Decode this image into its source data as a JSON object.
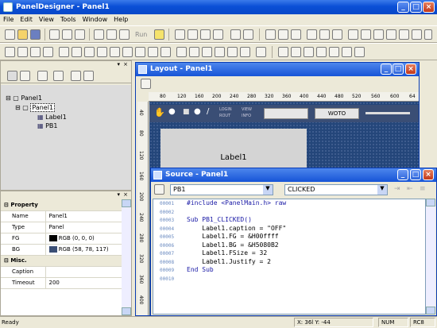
{
  "app": {
    "title": "PanelDesigner - Panel1"
  },
  "menu": [
    "File",
    "Edit",
    "View",
    "Tools",
    "Window",
    "Help"
  ],
  "toolbar": {
    "run_label": "Run"
  },
  "tree": {
    "root": "Panel1",
    "child": "Panel1",
    "items": [
      "Label1",
      "PB1"
    ]
  },
  "properties": {
    "section_property": "Property",
    "rows": [
      {
        "name": "Name",
        "value": "Panel1"
      },
      {
        "name": "Type",
        "value": "Panel"
      },
      {
        "name": "FG",
        "value": "RGB (0, 0, 0)",
        "swatch": "#000000"
      },
      {
        "name": "BG",
        "value": "RGB (58, 78, 117)",
        "swatch": "#3a4e75"
      }
    ],
    "section_misc": "Misc.",
    "misc_rows": [
      {
        "name": "Caption",
        "value": ""
      },
      {
        "name": "Timeout",
        "value": "200"
      }
    ]
  },
  "layout_window": {
    "title": "Layout - Panel1",
    "ruler_ticks": [
      "80",
      "120",
      "160",
      "200",
      "240",
      "280",
      "320",
      "360",
      "400",
      "440",
      "480",
      "520",
      "560",
      "600",
      "64"
    ],
    "vruler_ticks": [
      "40",
      "80",
      "120",
      "160",
      "200",
      "240",
      "280",
      "320",
      "360",
      "400"
    ],
    "label_text": "Label1",
    "mini_button": "WOTO",
    "mini_small_1": "LOGIN",
    "mini_small_2": "ROUT",
    "mini_small_3": "VIEW",
    "mini_small_4": "INFO"
  },
  "source_window": {
    "title": "Source - Panel1",
    "object_select": "PB1",
    "event_select": "CLICKED",
    "lines": [
      {
        "n": "00001",
        "code": "#include <PanelMain.h> raw"
      },
      {
        "n": "00002",
        "code": ""
      },
      {
        "n": "00003",
        "code": "Sub PB1_CLICKED()"
      },
      {
        "n": "00004",
        "code": "    Label1.caption = \"OFF\""
      },
      {
        "n": "00005",
        "code": "    Label1.FG = &H00ffff"
      },
      {
        "n": "00006",
        "code": "    Label1.BG = &H5080B2"
      },
      {
        "n": "00007",
        "code": "    Label1.FSize = 32"
      },
      {
        "n": "00008",
        "code": "    Label1.Justify = 2"
      },
      {
        "n": "00009",
        "code": "End Sub"
      },
      {
        "n": "00010",
        "code": ""
      }
    ]
  },
  "status": {
    "left": "Ready",
    "coords": "X:  36l Y:  -44",
    "num": "NUM",
    "rc": "RC8"
  },
  "colors": {
    "accent": "#0a4fd6",
    "grid": "#24467a"
  }
}
